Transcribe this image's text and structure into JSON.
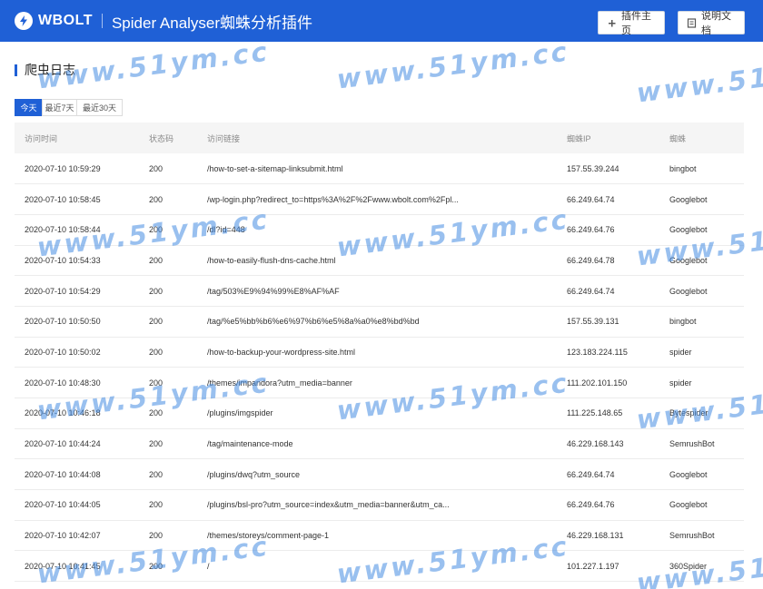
{
  "header": {
    "brand": "WBOLT",
    "title": "Spider Analyser蜘蛛分析插件",
    "buttons": {
      "plugin_home": "插件主页",
      "docs": "说明文档"
    }
  },
  "section": {
    "title": "爬虫日志"
  },
  "tabs": [
    {
      "label": "今天",
      "active": true
    },
    {
      "label": "最近7天",
      "active": false
    },
    {
      "label": "最近30天",
      "active": false
    }
  ],
  "table": {
    "columns": [
      "访问时间",
      "状态码",
      "访问链接",
      "蜘蛛IP",
      "蜘蛛"
    ],
    "rows": [
      {
        "time": "2020-07-10 10:59:29",
        "code": "200",
        "url": "/how-to-set-a-sitemap-linksubmit.html",
        "ip": "157.55.39.244",
        "spider": "bingbot"
      },
      {
        "time": "2020-07-10 10:58:45",
        "code": "200",
        "url": "/wp-login.php?redirect_to=https%3A%2F%2Fwww.wbolt.com%2Fpl...",
        "ip": "66.249.64.74",
        "spider": "Googlebot"
      },
      {
        "time": "2020-07-10 10:58:44",
        "code": "200",
        "url": "/dl?id=448",
        "ip": "66.249.64.76",
        "spider": "Googlebot"
      },
      {
        "time": "2020-07-10 10:54:33",
        "code": "200",
        "url": "/how-to-easily-flush-dns-cache.html",
        "ip": "66.249.64.78",
        "spider": "Googlebot"
      },
      {
        "time": "2020-07-10 10:54:29",
        "code": "200",
        "url": "/tag/503%E9%94%99%E8%AF%AF",
        "ip": "66.249.64.74",
        "spider": "Googlebot"
      },
      {
        "time": "2020-07-10 10:50:50",
        "code": "200",
        "url": "/tag/%e5%bb%b6%e6%97%b6%e5%8a%a0%e8%bd%bd",
        "ip": "157.55.39.131",
        "spider": "bingbot"
      },
      {
        "time": "2020-07-10 10:50:02",
        "code": "200",
        "url": "/how-to-backup-your-wordpress-site.html",
        "ip": "123.183.224.115",
        "spider": "spider"
      },
      {
        "time": "2020-07-10 10:48:30",
        "code": "200",
        "url": "/themes/impandora?utm_media=banner",
        "ip": "111.202.101.150",
        "spider": "spider"
      },
      {
        "time": "2020-07-10 10:46:18",
        "code": "200",
        "url": "/plugins/imgspider",
        "ip": "111.225.148.65",
        "spider": "Bytespider"
      },
      {
        "time": "2020-07-10 10:44:24",
        "code": "200",
        "url": "/tag/maintenance-mode",
        "ip": "46.229.168.143",
        "spider": "SemrushBot"
      },
      {
        "time": "2020-07-10 10:44:08",
        "code": "200",
        "url": "/plugins/dwq?utm_source",
        "ip": "66.249.64.74",
        "spider": "Googlebot"
      },
      {
        "time": "2020-07-10 10:44:05",
        "code": "200",
        "url": "/plugins/bsl-pro?utm_source=index&utm_media=banner&utm_ca...",
        "ip": "66.249.64.76",
        "spider": "Googlebot"
      },
      {
        "time": "2020-07-10 10:42:07",
        "code": "200",
        "url": "/themes/storeys/comment-page-1",
        "ip": "46.229.168.131",
        "spider": "SemrushBot"
      },
      {
        "time": "2020-07-10 10:41:45",
        "code": "200",
        "url": "/",
        "ip": "101.227.1.197",
        "spider": "360Spider"
      }
    ]
  },
  "watermark": {
    "text": "www.51ym.cc"
  },
  "colors": {
    "accent": "#1f60d6",
    "watermark": "#468ce1"
  },
  "icons": {
    "logo": "wbolt-logo-icon",
    "plugin_home": "plugin-icon",
    "docs": "document-icon"
  }
}
